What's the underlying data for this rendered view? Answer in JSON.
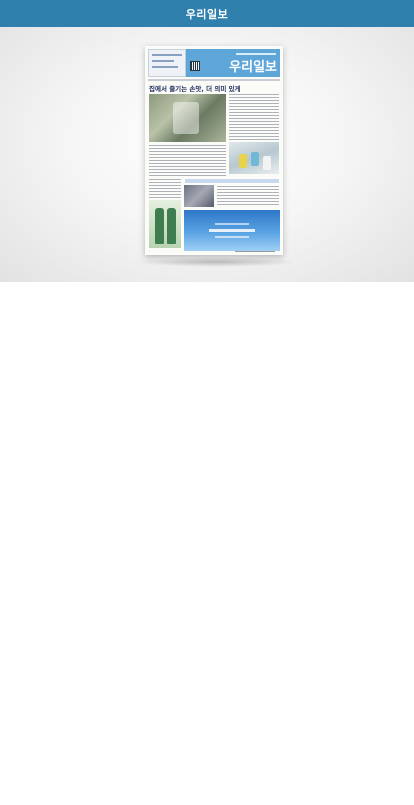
{
  "header": {
    "title": "우리일보"
  },
  "newspaper": {
    "masthead_name": "우리일보",
    "headline": "집에서 즐기는 손맛, 더 의미 있게"
  },
  "colors": {
    "app_bar": "#2f80ad",
    "masthead": "#5ea6d8",
    "ad": "#2f78c9"
  }
}
